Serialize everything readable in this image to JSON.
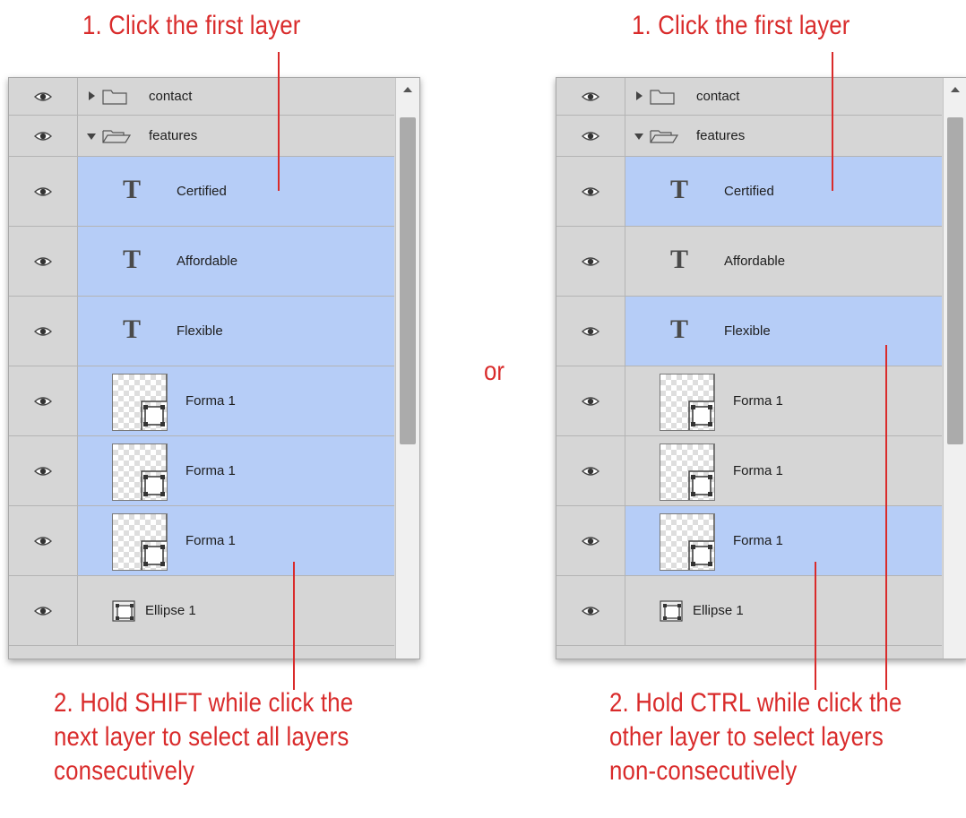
{
  "left": {
    "top_caption": "1. Click the first layer",
    "bottom_caption": [
      "2. Hold SHIFT while click the",
      "next layer to select all layers",
      "consecutively"
    ]
  },
  "right": {
    "top_caption": "1. Click the first layer",
    "bottom_caption": [
      "2. Hold CTRL while click the",
      "other layer to select layers",
      "non-consecutively"
    ]
  },
  "separator": "or",
  "layers": [
    {
      "name": "contact",
      "kind": "folder",
      "expanded": false
    },
    {
      "name": "features",
      "kind": "folder",
      "expanded": true
    },
    {
      "name": "Certified",
      "kind": "text",
      "icon": "T"
    },
    {
      "name": "Affordable",
      "kind": "text",
      "icon": "T"
    },
    {
      "name": "Flexible",
      "kind": "text",
      "icon": "T"
    },
    {
      "name": "Forma 1",
      "kind": "shape"
    },
    {
      "name": "Forma 1",
      "kind": "shape"
    },
    {
      "name": "Forma 1",
      "kind": "shape"
    },
    {
      "name": "Ellipse 1",
      "kind": "vector"
    }
  ],
  "selection": {
    "left": [
      2,
      3,
      4,
      5,
      6,
      7
    ],
    "right": [
      2,
      4,
      7
    ]
  },
  "colors": {
    "accent": "#d92b2b",
    "selected_row": "#b6cdf7",
    "row": "#d6d6d6"
  }
}
